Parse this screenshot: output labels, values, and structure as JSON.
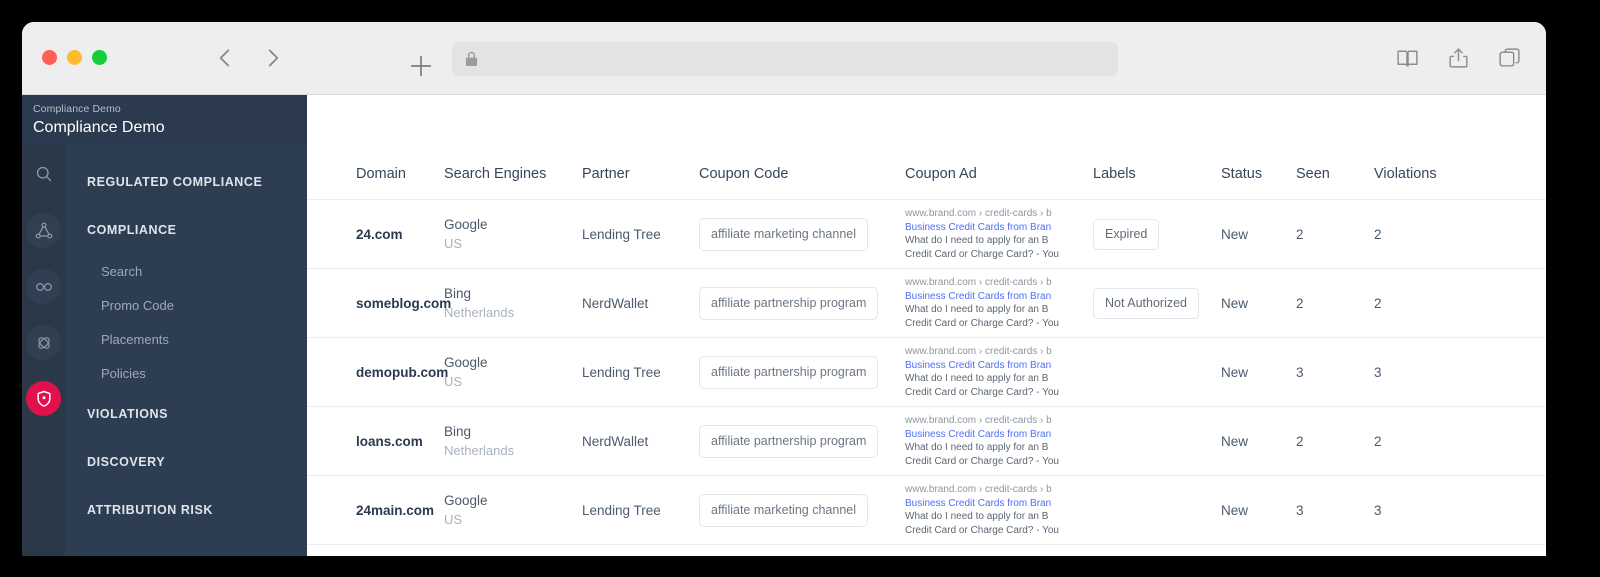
{
  "browser": {
    "traffic_lights": [
      "close",
      "minimize",
      "maximize"
    ],
    "back_label": "Back",
    "forward_label": "Forward",
    "new_tab_label": "New Tab",
    "url_value": "",
    "url_placeholder": "",
    "lock_icon": "lock-icon",
    "right_icons": [
      "book-icon",
      "share-icon",
      "tabs-icon"
    ],
    "colors": {
      "toolbar_bg": "#eeeeee",
      "urlbar_bg": "#e3e3e3",
      "light_red": "#ff5f56",
      "light_yellow": "#ffbd2e",
      "light_green": "#16ce38"
    }
  },
  "sidebar": {
    "eyebrow": "Compliance Demo",
    "title": "Compliance Demo",
    "rail_icons": [
      {
        "name": "search-icon",
        "state": "plain"
      },
      {
        "name": "network-nodes-icon",
        "state": "dim"
      },
      {
        "name": "infinity-icon",
        "state": "dim"
      },
      {
        "name": "atom-icon",
        "state": "dim"
      },
      {
        "name": "shield-icon",
        "state": "active"
      }
    ],
    "sections": [
      {
        "label": "REGULATED COMPLIANCE",
        "type": "section"
      },
      {
        "label": "COMPLIANCE",
        "type": "section"
      },
      {
        "label": "Search",
        "type": "sub"
      },
      {
        "label": "Promo Code",
        "type": "sub"
      },
      {
        "label": "Placements",
        "type": "sub"
      },
      {
        "label": "Policies",
        "type": "sub"
      },
      {
        "label": "VIOLATIONS",
        "type": "section"
      },
      {
        "label": "DISCOVERY",
        "type": "section"
      },
      {
        "label": "ATTRIBUTION RISK",
        "type": "section"
      }
    ],
    "colors": {
      "header_bg": "#2b3a4e",
      "panel_bg": "#2e3e52",
      "rail_bg": "#2a3848",
      "active_badge": "#e4104b"
    }
  },
  "table": {
    "columns": [
      "Domain",
      "Search Engines",
      "Partner",
      "Coupon Code",
      "Coupon Ad",
      "Labels",
      "Status",
      "Seen",
      "Violations"
    ],
    "ad_lines": {
      "url": "www.brand.com › credit-cards › b",
      "title": "Business Credit Cards from Bran",
      "desc1": "What do I need to apply for an B",
      "desc2": "Credit Card or Charge Card? - You"
    },
    "rows": [
      {
        "domain": "24.com",
        "engine": "Google",
        "geo": "US",
        "partner": "Lending Tree",
        "coupon_code": "affiliate marketing channel",
        "label": "Expired",
        "status": "New",
        "seen": "2",
        "violations": "2"
      },
      {
        "domain": "someblog.com",
        "engine": "Bing",
        "geo": "Netherlands",
        "partner": "NerdWallet",
        "coupon_code": "affiliate partnership program",
        "label": "Not Authorized",
        "status": "New",
        "seen": "2",
        "violations": "2"
      },
      {
        "domain": "demopub.com",
        "engine": "Google",
        "geo": "US",
        "partner": "Lending Tree",
        "coupon_code": "affiliate partnership program",
        "label": "",
        "status": "New",
        "seen": "3",
        "violations": "3"
      },
      {
        "domain": "loans.com",
        "engine": "Bing",
        "geo": "Netherlands",
        "partner": "NerdWallet",
        "coupon_code": "affiliate partnership program",
        "label": "",
        "status": "New",
        "seen": "2",
        "violations": "2"
      },
      {
        "domain": "24main.com",
        "engine": "Google",
        "geo": "US",
        "partner": "Lending Tree",
        "coupon_code": "affiliate marketing channel",
        "label": "",
        "status": "New",
        "seen": "3",
        "violations": "3"
      }
    ]
  }
}
